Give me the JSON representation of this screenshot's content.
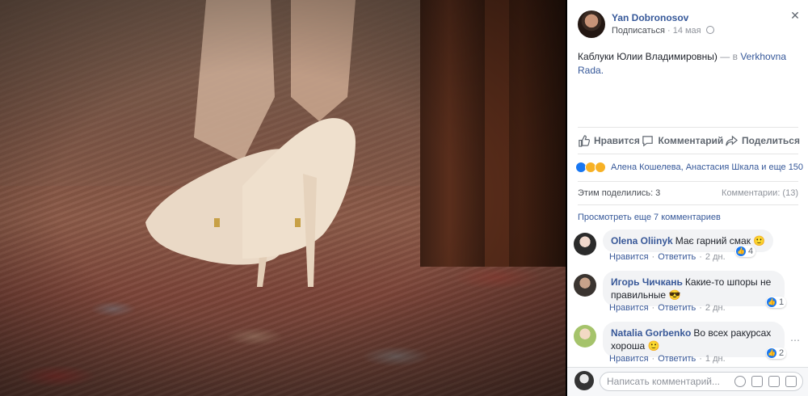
{
  "post": {
    "author": "Yan Dobronosov",
    "subscribe": "Подписаться",
    "separator": "·",
    "date": "14 мая",
    "text_main": "Каблуки Юлии Владимировны)",
    "text_dash": " — в ",
    "location": "Verkhovna Rada",
    "text_end": "."
  },
  "actions": {
    "like": "Нравится",
    "comment": "Комментарий",
    "share": "Поделиться"
  },
  "reactions": {
    "names": "Алена Кошелева, Анастасия Шкала и еще 150"
  },
  "stats": {
    "shares": "Этим поделились: 3",
    "comments": "Комментарии: (13)"
  },
  "prev_comments": "Просмотреть еще 7 комментариев",
  "comments": [
    {
      "name": "Olena Oliinyk",
      "text": "Має гарний смак 🙂",
      "like": "Нравится",
      "reply": "Ответить",
      "time": "2 дн.",
      "likes": "4"
    },
    {
      "name": "Игорь Чичкань",
      "text": "Какие-то шпоры не правильные 😎",
      "like": "Нравится",
      "reply": "Ответить",
      "time": "2 дн.",
      "likes": "1"
    },
    {
      "name": "Natalia Gorbenko",
      "text": "Во всех ракурсах хороша 🙂",
      "like": "Нравится",
      "reply": "Ответить",
      "time": "1 дн.",
      "likes": "2"
    }
  ],
  "composer": {
    "placeholder": "Написать комментарий..."
  },
  "colors": {
    "link": "#365899",
    "muted": "#90949c",
    "like_blue": "#1877f2"
  }
}
